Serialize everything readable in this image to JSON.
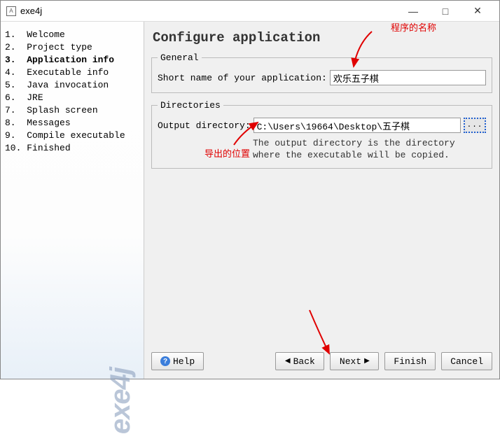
{
  "window": {
    "title": "exe4j",
    "icon_letter": "A"
  },
  "sidebar": {
    "items": [
      {
        "num": "1.",
        "label": "Welcome"
      },
      {
        "num": "2.",
        "label": "Project type"
      },
      {
        "num": "3.",
        "label": "Application info",
        "active": true
      },
      {
        "num": "4.",
        "label": "Executable info"
      },
      {
        "num": "5.",
        "label": "Java invocation"
      },
      {
        "num": "6.",
        "label": "JRE"
      },
      {
        "num": "7.",
        "label": "Splash screen"
      },
      {
        "num": "8.",
        "label": "Messages"
      },
      {
        "num": "9.",
        "label": "Compile executable"
      },
      {
        "num": "10.",
        "label": "Finished"
      }
    ],
    "watermark": "exe4j"
  },
  "main": {
    "title": "Configure application",
    "general": {
      "legend": "General",
      "short_name_label": "Short name of your application:",
      "short_name_value": "欢乐五子棋"
    },
    "directories": {
      "legend": "Directories",
      "outdir_label": "Output directory:",
      "outdir_value": "C:\\Users\\19664\\Desktop\\五子棋",
      "browse_label": "...",
      "hint": "The output directory is the directory where the executable will be copied."
    }
  },
  "buttons": {
    "help": "Help",
    "back": "Back",
    "next": "Next",
    "finish": "Finish",
    "cancel": "Cancel"
  },
  "annotations": {
    "name": "程序的名称",
    "outdir": "导出的位置"
  }
}
